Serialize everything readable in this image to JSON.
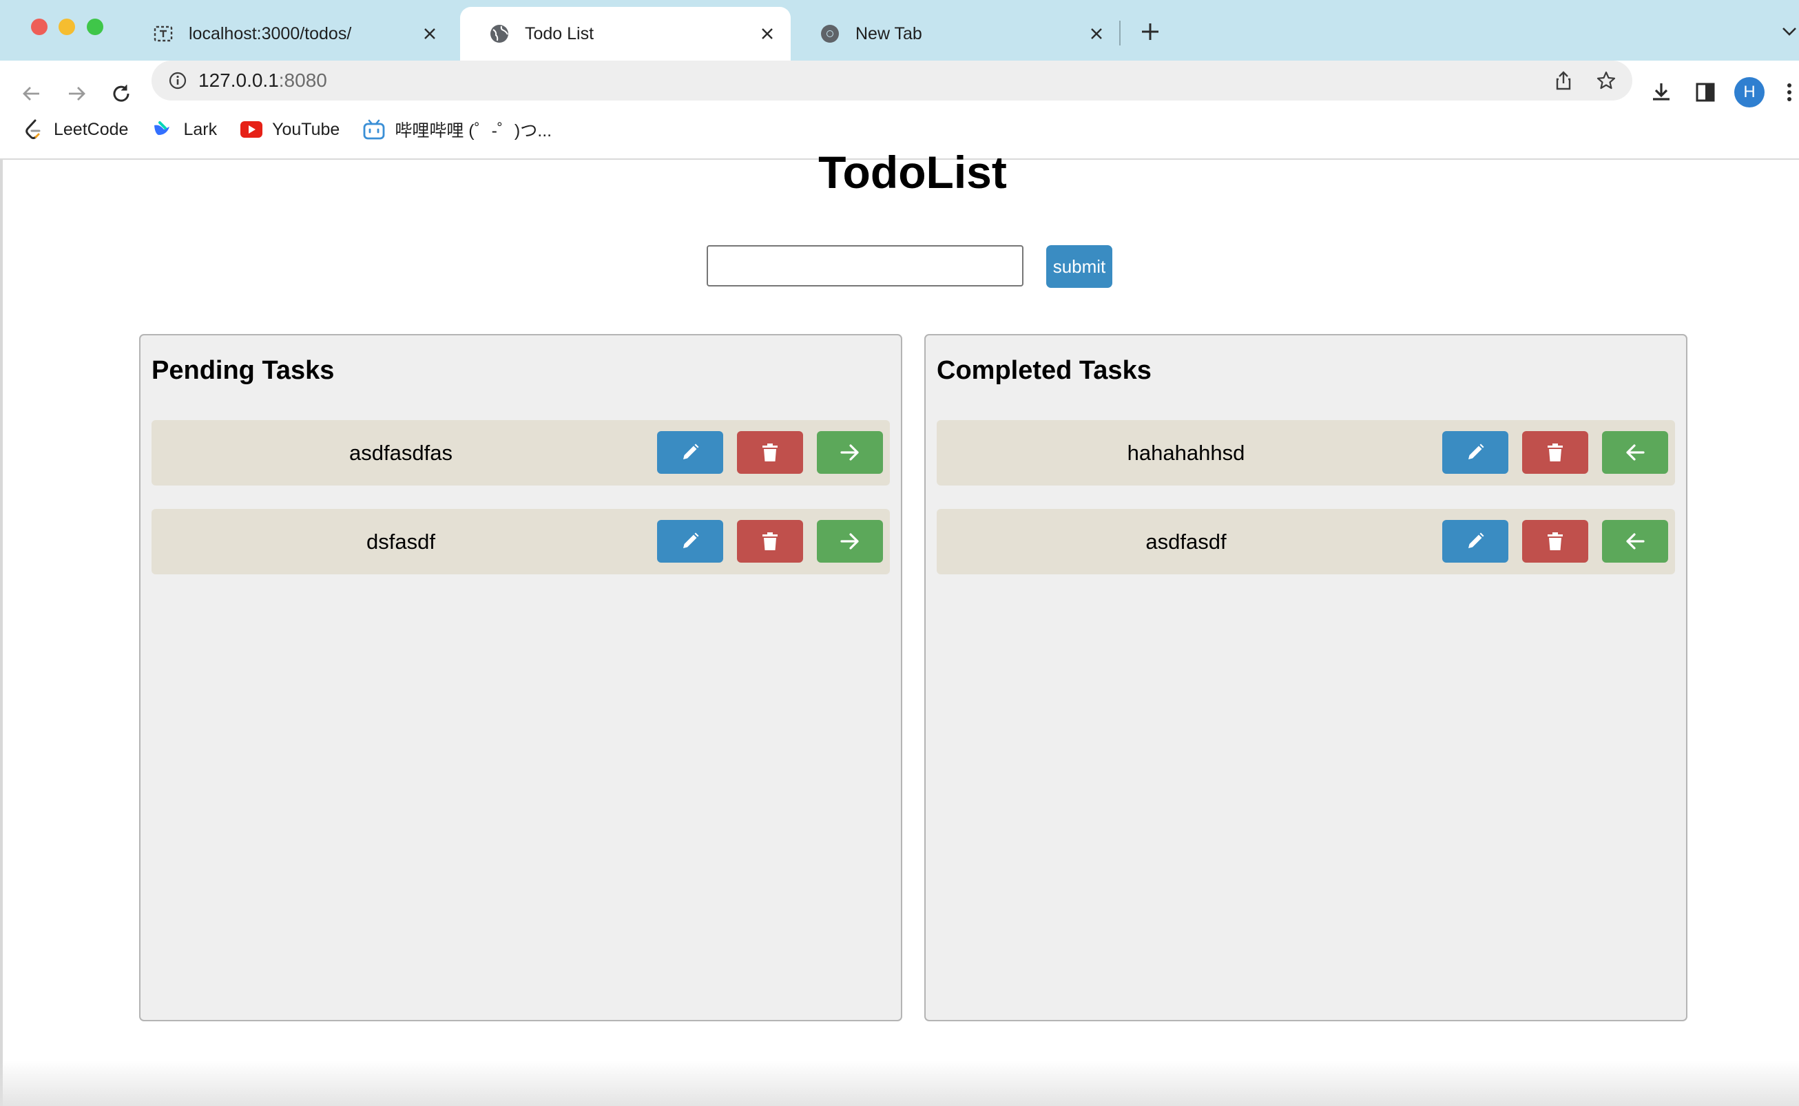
{
  "browser": {
    "tabs": [
      {
        "title": "localhost:3000/todos/",
        "icon": "dev-server-icon",
        "active": false
      },
      {
        "title": "Todo List",
        "icon": "globe-icon",
        "active": true
      },
      {
        "title": "New Tab",
        "icon": "chrome-icon",
        "active": false
      }
    ],
    "url_host": "127.0.0.1",
    "url_port": ":8080",
    "avatar_letter": "H",
    "bookmarks": [
      {
        "label": "LeetCode",
        "icon": "leetcode-icon"
      },
      {
        "label": "Lark",
        "icon": "lark-icon"
      },
      {
        "label": "YouTube",
        "icon": "youtube-icon"
      },
      {
        "label": "哔哩哔哩 (゜-゜)つ...",
        "icon": "bilibili-icon"
      }
    ]
  },
  "app": {
    "title": "TodoList",
    "input_value": "",
    "submit_label": "submit",
    "pending": {
      "title": "Pending Tasks",
      "tasks": [
        "asdfasdfas",
        "dsfasdf"
      ]
    },
    "completed": {
      "title": "Completed Tasks",
      "tasks": [
        "hahahahhsd",
        "asdfasdf"
      ]
    }
  },
  "colors": {
    "edit": "#3a8cc2",
    "delete": "#c0504c",
    "move": "#5ca85a",
    "task_bg": "#e4e0d4",
    "panel_bg": "#efefef",
    "tabstrip_bg": "#c5e4ef"
  }
}
